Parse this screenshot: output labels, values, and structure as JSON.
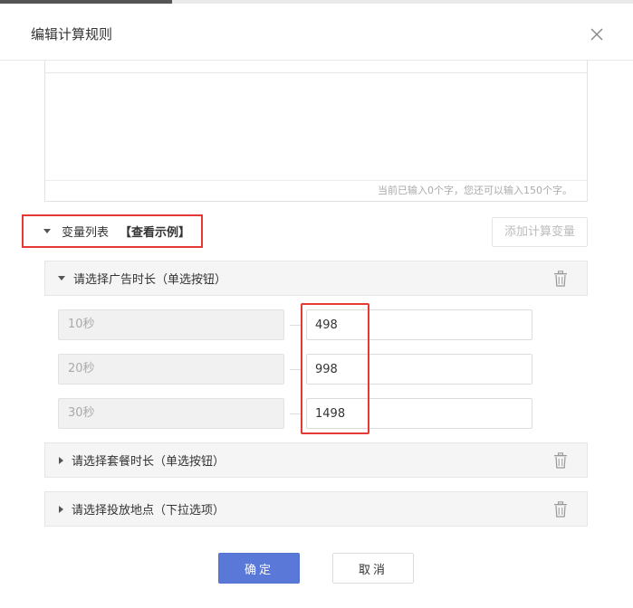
{
  "dialog": {
    "title": "编辑计算规则"
  },
  "editor": {
    "counter_text": "当前已输入0个字，您还可以输入150个字。"
  },
  "variables": {
    "toggle_label": "变量列表",
    "example_link": "【查看示例】",
    "add_button": "添加计算变量",
    "groups": [
      {
        "label": "请选择广告时长（单选按钮）",
        "expanded": true,
        "options": [
          {
            "label": "10秒",
            "value": "498"
          },
          {
            "label": "20秒",
            "value": "998"
          },
          {
            "label": "30秒",
            "value": "1498"
          }
        ]
      },
      {
        "label": "请选择套餐时长（单选按钮）",
        "expanded": false
      },
      {
        "label": "请选择投放地点（下拉选项）",
        "expanded": false
      }
    ]
  },
  "footer": {
    "ok_label": "确定",
    "cancel_label": "取消"
  },
  "colors": {
    "primary": "#5a78d8",
    "highlight": "#e53935"
  }
}
